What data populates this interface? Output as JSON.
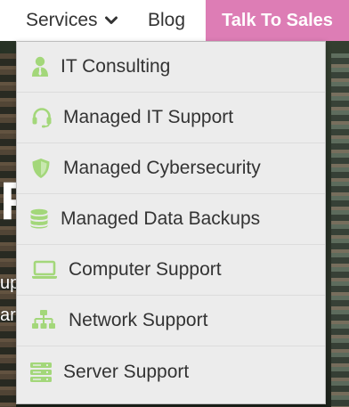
{
  "nav": {
    "services_label": "Services",
    "blog_label": "Blog",
    "cta_label": "Talk To Sales"
  },
  "hero": {
    "big_fragment": "F",
    "line1_fragment": "up",
    "line2_fragment": "ar"
  },
  "dropdown": {
    "items": [
      {
        "label": "IT Consulting",
        "icon": "consultant-icon"
      },
      {
        "label": "Managed IT Support",
        "icon": "headset-icon"
      },
      {
        "label": "Managed Cybersecurity",
        "icon": "shield-icon"
      },
      {
        "label": "Managed Data Backups",
        "icon": "database-icon"
      },
      {
        "label": "Computer Support",
        "icon": "laptop-icon"
      },
      {
        "label": "Network Support",
        "icon": "network-icon"
      },
      {
        "label": "Server Support",
        "icon": "server-icon"
      }
    ]
  },
  "colors": {
    "cta_background": "#dd7db5",
    "icon_green": "#a3d77a",
    "dropdown_background": "#ececec",
    "text": "#333333"
  }
}
